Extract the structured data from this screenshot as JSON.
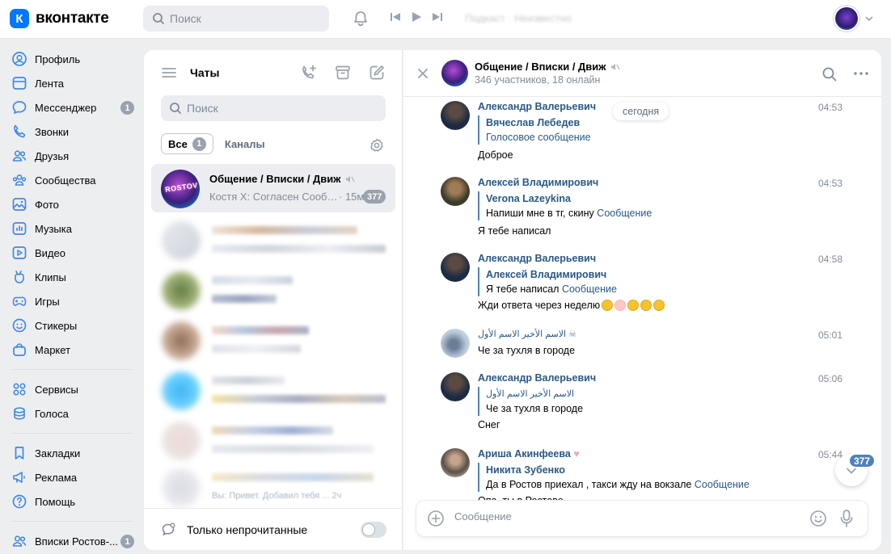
{
  "header": {
    "logo_mark": "К",
    "logo_text": "вконтакте",
    "search_placeholder": "Поиск",
    "player_text": "Подкаст · Неизвестно"
  },
  "nav": {
    "items": [
      {
        "label": "Профиль"
      },
      {
        "label": "Лента"
      },
      {
        "label": "Мессенджер",
        "badge": "1"
      },
      {
        "label": "Звонки"
      },
      {
        "label": "Друзья"
      },
      {
        "label": "Сообщества"
      },
      {
        "label": "Фото"
      },
      {
        "label": "Музыка"
      },
      {
        "label": "Видео"
      },
      {
        "label": "Клипы"
      },
      {
        "label": "Игры"
      },
      {
        "label": "Стикеры"
      },
      {
        "label": "Маркет"
      }
    ],
    "services": [
      {
        "label": "Сервисы"
      },
      {
        "label": "Голоса"
      }
    ],
    "misc": [
      {
        "label": "Закладки"
      },
      {
        "label": "Реклама"
      },
      {
        "label": "Помощь"
      }
    ],
    "group": {
      "label": "Вписки Ростов-...",
      "badge": "1"
    }
  },
  "chatlist": {
    "title": "Чаты",
    "search_placeholder": "Поиск",
    "tabs": [
      {
        "label": "Все",
        "badge": "1"
      },
      {
        "label": "Каналы"
      }
    ],
    "active_chat": {
      "avatar_text": "ROSTOV",
      "title": "Общение / Вписки / Движ",
      "preview": "Костя Х: Согласен Сообщение",
      "time": "· 15м",
      "badge": "377"
    },
    "blurred_preview": "Вы: Привет. Добавил тебя ... 2ч",
    "footer_label": "Только непрочитанные"
  },
  "conversation": {
    "title": "Общение / Вписки / Движ",
    "subtitle": "346 участников, 18 онлайн",
    "date_pill": "сегодня",
    "messages": [
      {
        "author": "Александр Валерьевич",
        "time": "04:53",
        "quote_author": "Вячеслав Лебедев",
        "quote_text": "Голосовое сообщение",
        "text": "Доброе"
      },
      {
        "author": "Алексей Владимирович",
        "time": "04:53",
        "quote_author": "Verona Lazeykina",
        "quote_text": "Напиши мне в тг, скину",
        "quote_link": "Сообщение",
        "text": "Я тебе написал"
      },
      {
        "author": "Александр Валерьевич",
        "time": "04:58",
        "quote_author": "Алексей Владимирович",
        "quote_text": "Я тебе написал",
        "quote_link": "Сообщение",
        "text": "Жди ответа через неделю"
      },
      {
        "author": "الاسم الأخير الاسم الأول",
        "time": "05:01",
        "text": "Че за тухля в городе"
      },
      {
        "author": "Александр Валерьевич",
        "time": "05:06",
        "quote_author": "الاسم الأخير الاسم الأول",
        "quote_text": "Че за тухля в городе",
        "text": "Снег"
      },
      {
        "author": "Ариша Акинфеева",
        "time": "05:44",
        "quote_author": "Никита Зубенко",
        "quote_text": "Да в Ростов приехал , такси жду на вокзале",
        "quote_link": "Сообщение",
        "text": "Опа, ты в Ростове"
      }
    ],
    "unread_badge": "377",
    "composer_placeholder": "Сообщение"
  },
  "colors": {
    "accent": "#0077ff",
    "link": "#2a5885",
    "badge": "#99a2ad",
    "secondary_text": "#818c99"
  }
}
